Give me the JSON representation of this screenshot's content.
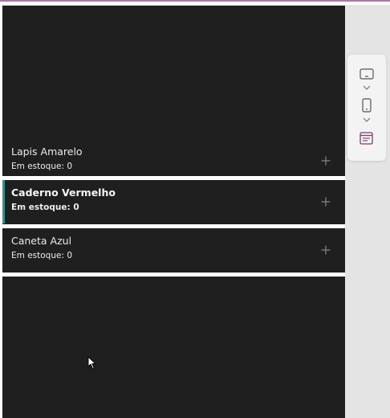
{
  "gallery": {
    "items": [
      {
        "title": "Lapis Amarelo",
        "stock_label": "Em estoque: 0"
      },
      {
        "title": "Caderno Vermelho",
        "stock_label": "Em estoque: 0"
      },
      {
        "title": "Caneta Azul",
        "stock_label": "Em estoque: 0"
      }
    ],
    "selected_index": 1
  },
  "side_toolbar": {
    "icons": [
      "tablet-landscape-icon",
      "chevron-down-icon",
      "phone-icon",
      "chevron-down-icon",
      "calendar-form-icon"
    ]
  },
  "colors": {
    "top_accent": "#a97aa2",
    "canvas_background": "#1f1f1f",
    "selection_bar": "#3a8f8f",
    "toolbar_active_icon": "#7a3f73"
  }
}
